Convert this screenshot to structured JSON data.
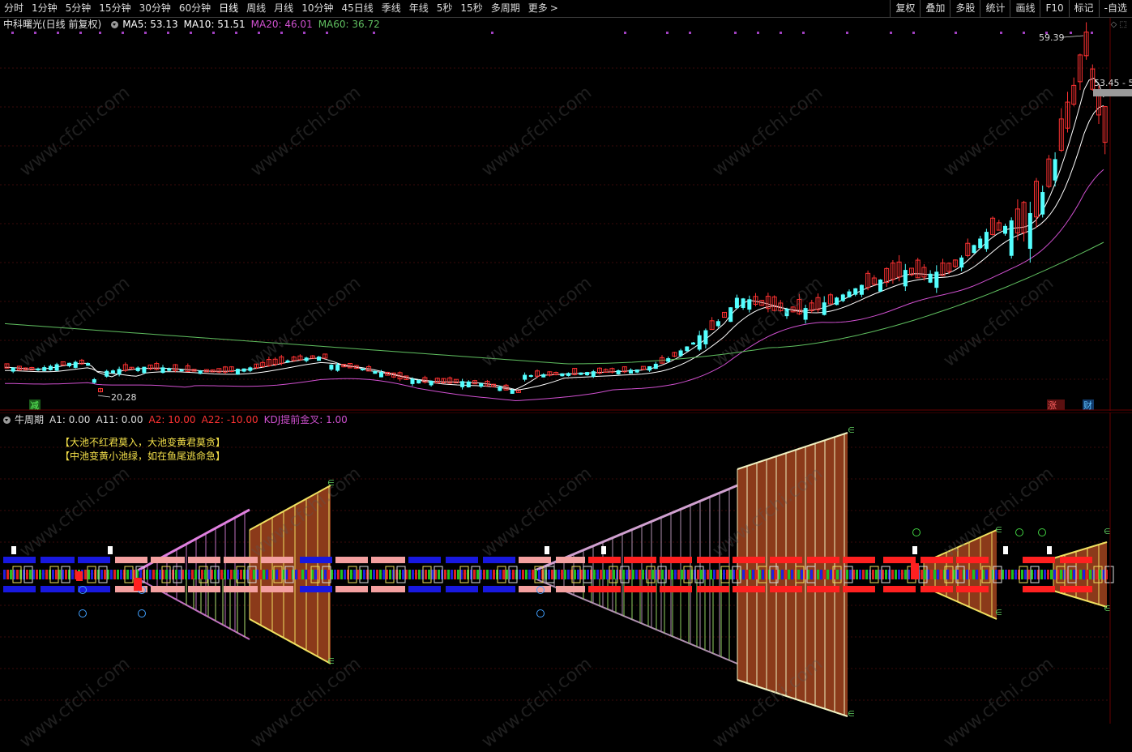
{
  "toolbar": {
    "periods": [
      "分时",
      "1分钟",
      "5分钟",
      "15分钟",
      "30分钟",
      "60分钟",
      "日线",
      "周线",
      "月线",
      "10分钟",
      "45日线",
      "季线",
      "年线",
      "5秒",
      "15秒",
      "多周期",
      "更多"
    ],
    "more_chevron": ">",
    "tools": [
      "复权",
      "叠加",
      "多股",
      "统计",
      "画线",
      "F10",
      "标记",
      "-自选"
    ]
  },
  "main_chart": {
    "stock_title": "中科曙光(日线 前复权)",
    "ma_labels": [
      {
        "text": "MA5: 53.13",
        "color": "#ffffff"
      },
      {
        "text": "MA10: 51.51",
        "color": "#ffffff"
      },
      {
        "text": "MA20: 46.01",
        "color": "#d050d0"
      },
      {
        "text": "MA60: 36.72",
        "color": "#60c060"
      }
    ],
    "high_label": "59.39",
    "low_label": "20.28",
    "current_label": "53.45 - 5",
    "left_marker": "减",
    "right_markers": [
      "涨",
      "财"
    ],
    "colors": {
      "up": "#ff3232",
      "down": "#54ffff",
      "ma5": "#ffffff",
      "ma10": "#ffffff",
      "ma20": "#d050d0",
      "ma60": "#60c060"
    },
    "corner_icons": "◇ ⬚"
  },
  "sub_chart": {
    "indicator_title": "牛周期",
    "params": [
      {
        "text": "A1: 0.00",
        "color": "#dcdcdc"
      },
      {
        "text": "A11: 0.00",
        "color": "#dcdcdc"
      },
      {
        "text": "A2: 10.00",
        "color": "#ff3232"
      },
      {
        "text": "A22: -10.00",
        "color": "#ff3232"
      },
      {
        "text": "KDJ提前金叉: 1.00",
        "color": "#d050d0"
      }
    ],
    "notes": [
      "【大池不红君莫入，大池变黄君莫贪】",
      "【中池变黄小池绿，如在鱼尾逃命急】"
    ]
  },
  "watermark_text": "www.cfchi.com"
}
